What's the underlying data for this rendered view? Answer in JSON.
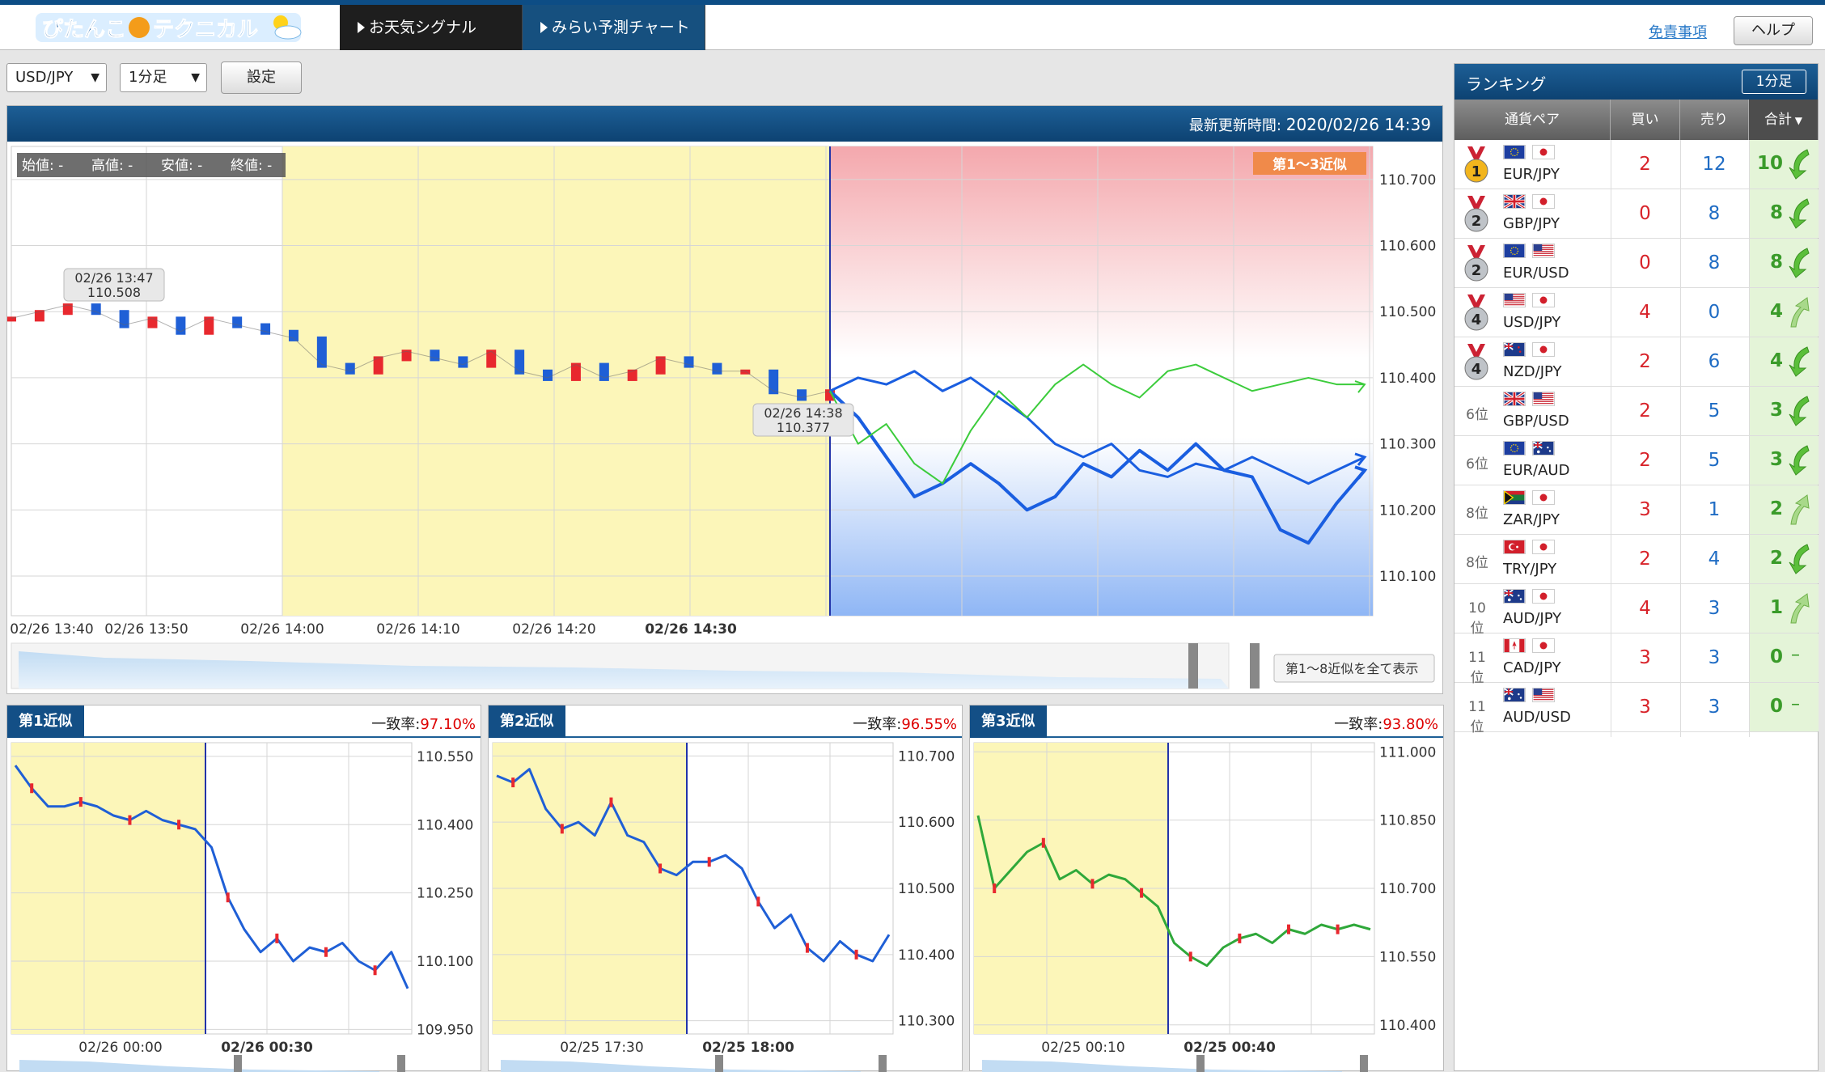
{
  "header": {
    "logo_text": "ぴたんこテクニカル",
    "tabs": [
      "お天気シグナル",
      "みらい予測チャート"
    ],
    "disclaimer": "免責事項",
    "help": "ヘルプ"
  },
  "toolbar": {
    "pair": "USD/JPY",
    "timeframe": "1分足",
    "settings": "設定"
  },
  "main": {
    "update_label": "最新更新時間:",
    "update_time": "2020/02/26 14:39",
    "ohlc": [
      "始値: -",
      "高値: -",
      "安値: -",
      "終値: -"
    ],
    "badge": "第1〜3近似",
    "show_all": "第1〜8近似を全て表示",
    "tooltip1": {
      "time": "02/26 13:47",
      "price": "110.508"
    },
    "tooltip2": {
      "time": "02/26 14:38",
      "price": "110.377"
    }
  },
  "chart_data": [
    {
      "type": "line",
      "title": "USD/JPY 1分足",
      "x_labels": [
        "02/26 13:40",
        "02/26 13:50",
        "02/26 14:00",
        "02/26 14:10",
        "02/26 14:20",
        "02/26 14:30"
      ],
      "y_ticks": [
        "110.700",
        "110.600",
        "110.500",
        "110.400",
        "110.300",
        "110.200",
        "110.100"
      ],
      "ylim": [
        110.04,
        110.75
      ],
      "series": [
        {
          "values": [
            110.49,
            110.5,
            110.51,
            110.5,
            110.48,
            110.49,
            110.47,
            110.49,
            110.48,
            110.47,
            110.46,
            110.42,
            110.41,
            110.43,
            110.44,
            110.43,
            110.42,
            110.44,
            110.41,
            110.4,
            110.42,
            110.4,
            110.41,
            110.43,
            110.42,
            110.41,
            110.41,
            110.38,
            110.37,
            110.38
          ]
        },
        {
          "values": [
            110.38,
            110.34,
            110.28,
            110.22,
            110.24,
            110.27,
            110.24,
            110.2,
            110.22,
            110.27,
            110.25,
            110.29,
            110.26,
            110.3,
            110.26,
            110.25,
            110.17,
            110.15,
            110.21,
            110.26
          ]
        },
        {
          "values": [
            110.38,
            110.4,
            110.39,
            110.41,
            110.38,
            110.4,
            110.37,
            110.34,
            110.3,
            110.28,
            110.3,
            110.26,
            110.25,
            110.27,
            110.26,
            110.28,
            110.26,
            110.24,
            110.26,
            110.28
          ]
        },
        {
          "values": [
            110.38,
            110.3,
            110.33,
            110.27,
            110.24,
            110.32,
            110.38,
            110.34,
            110.39,
            110.42,
            110.39,
            110.37,
            110.41,
            110.42,
            110.4,
            110.38,
            110.39,
            110.4,
            110.39,
            110.39
          ]
        }
      ]
    },
    {
      "type": "line",
      "title": "第1近似",
      "x_labels": [
        "02/26 00:00",
        "02/26 00:30"
      ],
      "y_ticks": [
        "110.550",
        "110.400",
        "110.250",
        "110.100",
        "109.950"
      ],
      "ylim": [
        109.94,
        110.58
      ],
      "values": [
        110.53,
        110.48,
        110.44,
        110.44,
        110.45,
        110.44,
        110.42,
        110.41,
        110.43,
        110.41,
        110.4,
        110.39,
        110.35,
        110.24,
        110.17,
        110.12,
        110.15,
        110.1,
        110.13,
        110.12,
        110.14,
        110.1,
        110.08,
        110.12,
        110.04
      ]
    },
    {
      "type": "line",
      "title": "第2近似",
      "x_labels": [
        "02/25 17:30",
        "02/25 18:00"
      ],
      "y_ticks": [
        "110.700",
        "110.600",
        "110.500",
        "110.400",
        "110.300"
      ],
      "ylim": [
        110.28,
        110.72
      ],
      "values": [
        110.67,
        110.66,
        110.68,
        110.62,
        110.59,
        110.6,
        110.58,
        110.63,
        110.58,
        110.57,
        110.53,
        110.52,
        110.54,
        110.54,
        110.55,
        110.53,
        110.48,
        110.44,
        110.46,
        110.41,
        110.39,
        110.42,
        110.4,
        110.39,
        110.43
      ]
    },
    {
      "type": "line",
      "title": "第3近似",
      "x_labels": [
        "02/25 00:10",
        "02/25 00:40"
      ],
      "y_ticks": [
        "111.000",
        "110.850",
        "110.700",
        "110.550",
        "110.400"
      ],
      "ylim": [
        110.38,
        111.02
      ],
      "values": [
        110.86,
        110.7,
        110.74,
        110.78,
        110.8,
        110.72,
        110.74,
        110.71,
        110.73,
        110.72,
        110.69,
        110.66,
        110.58,
        110.55,
        110.53,
        110.57,
        110.59,
        110.6,
        110.58,
        110.61,
        110.6,
        110.62,
        110.61,
        110.62,
        110.61
      ]
    }
  ],
  "subcharts": [
    {
      "title": "第1近似",
      "rate_label": "一致率:",
      "rate": "97.10%"
    },
    {
      "title": "第2近似",
      "rate_label": "一致率:",
      "rate": "96.55%"
    },
    {
      "title": "第3近似",
      "rate_label": "一致率:",
      "rate": "93.80%"
    }
  ],
  "ranking": {
    "title": "ランキング",
    "badge": "1分足",
    "columns": [
      "通貨ペア",
      "買い",
      "売り",
      "合計"
    ],
    "rows": [
      {
        "rank": "1",
        "medal": "gold",
        "pair": "EUR/JPY",
        "f1": "eu",
        "f2": "jp",
        "buy": "2",
        "sell": "12",
        "total": "10",
        "dir": "down"
      },
      {
        "rank": "2",
        "medal": "silver",
        "pair": "GBP/JPY",
        "f1": "gb",
        "f2": "jp",
        "buy": "0",
        "sell": "8",
        "total": "8",
        "dir": "down"
      },
      {
        "rank": "2",
        "medal": "silver",
        "pair": "EUR/USD",
        "f1": "eu",
        "f2": "us",
        "buy": "0",
        "sell": "8",
        "total": "8",
        "dir": "down"
      },
      {
        "rank": "4",
        "medal": "silver",
        "pair": "USD/JPY",
        "f1": "us",
        "f2": "jp",
        "buy": "4",
        "sell": "0",
        "total": "4",
        "dir": "up"
      },
      {
        "rank": "4",
        "medal": "silver",
        "pair": "NZD/JPY",
        "f1": "nz",
        "f2": "jp",
        "buy": "2",
        "sell": "6",
        "total": "4",
        "dir": "down"
      },
      {
        "rank": "6位",
        "medal": "",
        "pair": "GBP/USD",
        "f1": "gb",
        "f2": "us",
        "buy": "2",
        "sell": "5",
        "total": "3",
        "dir": "down"
      },
      {
        "rank": "6位",
        "medal": "",
        "pair": "EUR/AUD",
        "f1": "eu",
        "f2": "au",
        "buy": "2",
        "sell": "5",
        "total": "3",
        "dir": "down"
      },
      {
        "rank": "8位",
        "medal": "",
        "pair": "ZAR/JPY",
        "f1": "za",
        "f2": "jp",
        "buy": "3",
        "sell": "1",
        "total": "2",
        "dir": "up"
      },
      {
        "rank": "8位",
        "medal": "",
        "pair": "TRY/JPY",
        "f1": "tr",
        "f2": "jp",
        "buy": "2",
        "sell": "4",
        "total": "2",
        "dir": "down"
      },
      {
        "rank": "10位",
        "medal": "",
        "pair": "AUD/JPY",
        "f1": "au",
        "f2": "jp",
        "buy": "4",
        "sell": "3",
        "total": "1",
        "dir": "up"
      },
      {
        "rank": "11位",
        "medal": "",
        "pair": "CAD/JPY",
        "f1": "ca",
        "f2": "jp",
        "buy": "3",
        "sell": "3",
        "total": "0",
        "dir": "flat"
      },
      {
        "rank": "11位",
        "medal": "",
        "pair": "AUD/USD",
        "f1": "au",
        "f2": "us",
        "buy": "3",
        "sell": "3",
        "total": "0",
        "dir": "flat"
      }
    ]
  }
}
